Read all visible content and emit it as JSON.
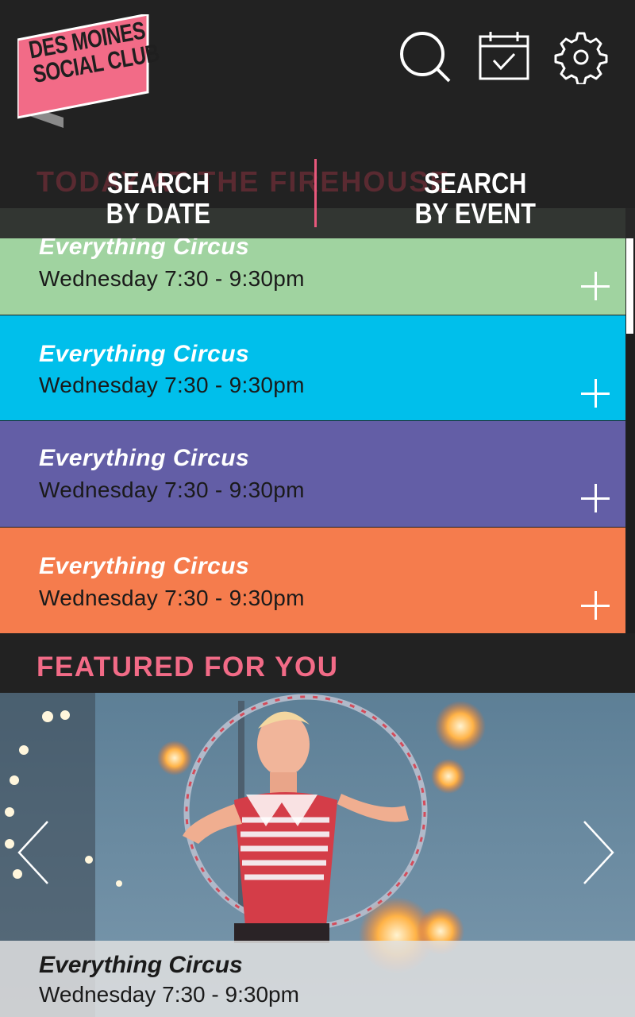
{
  "header": {
    "logo_line1": "DES MOINES",
    "logo_line2": "SOCIAL CLUB",
    "logo_color": "#f26b87",
    "icons": [
      "search-icon",
      "calendar-check-icon",
      "gear-icon"
    ]
  },
  "search_tabs": {
    "date_line1": "SEARCH",
    "date_line2": "BY DATE",
    "event_line1": "SEARCH",
    "event_line2": "BY EVENT",
    "divider_color": "#e8587c"
  },
  "ghost_heading": "TODAY AT THE FIREHOUSE",
  "events": [
    {
      "title": "Everything Circus",
      "time": "Wednesday 7:30 - 9:30pm",
      "color": "#a0d3a0"
    },
    {
      "title": "Everything Circus",
      "time": "Wednesday 7:30 - 9:30pm",
      "color": "#00bfeb"
    },
    {
      "title": "Everything Circus",
      "time": "Wednesday 7:30 - 9:30pm",
      "color": "#635ea6"
    },
    {
      "title": "Everything Circus",
      "time": "Wednesday 7:30 - 9:30pm",
      "color": "#f57c4d"
    }
  ],
  "featured": {
    "heading": "FEATURED FOR YOU",
    "heading_color": "#f26b87",
    "title": "Everything Circus",
    "time": "Wednesday 7:30 - 9:30pm"
  }
}
